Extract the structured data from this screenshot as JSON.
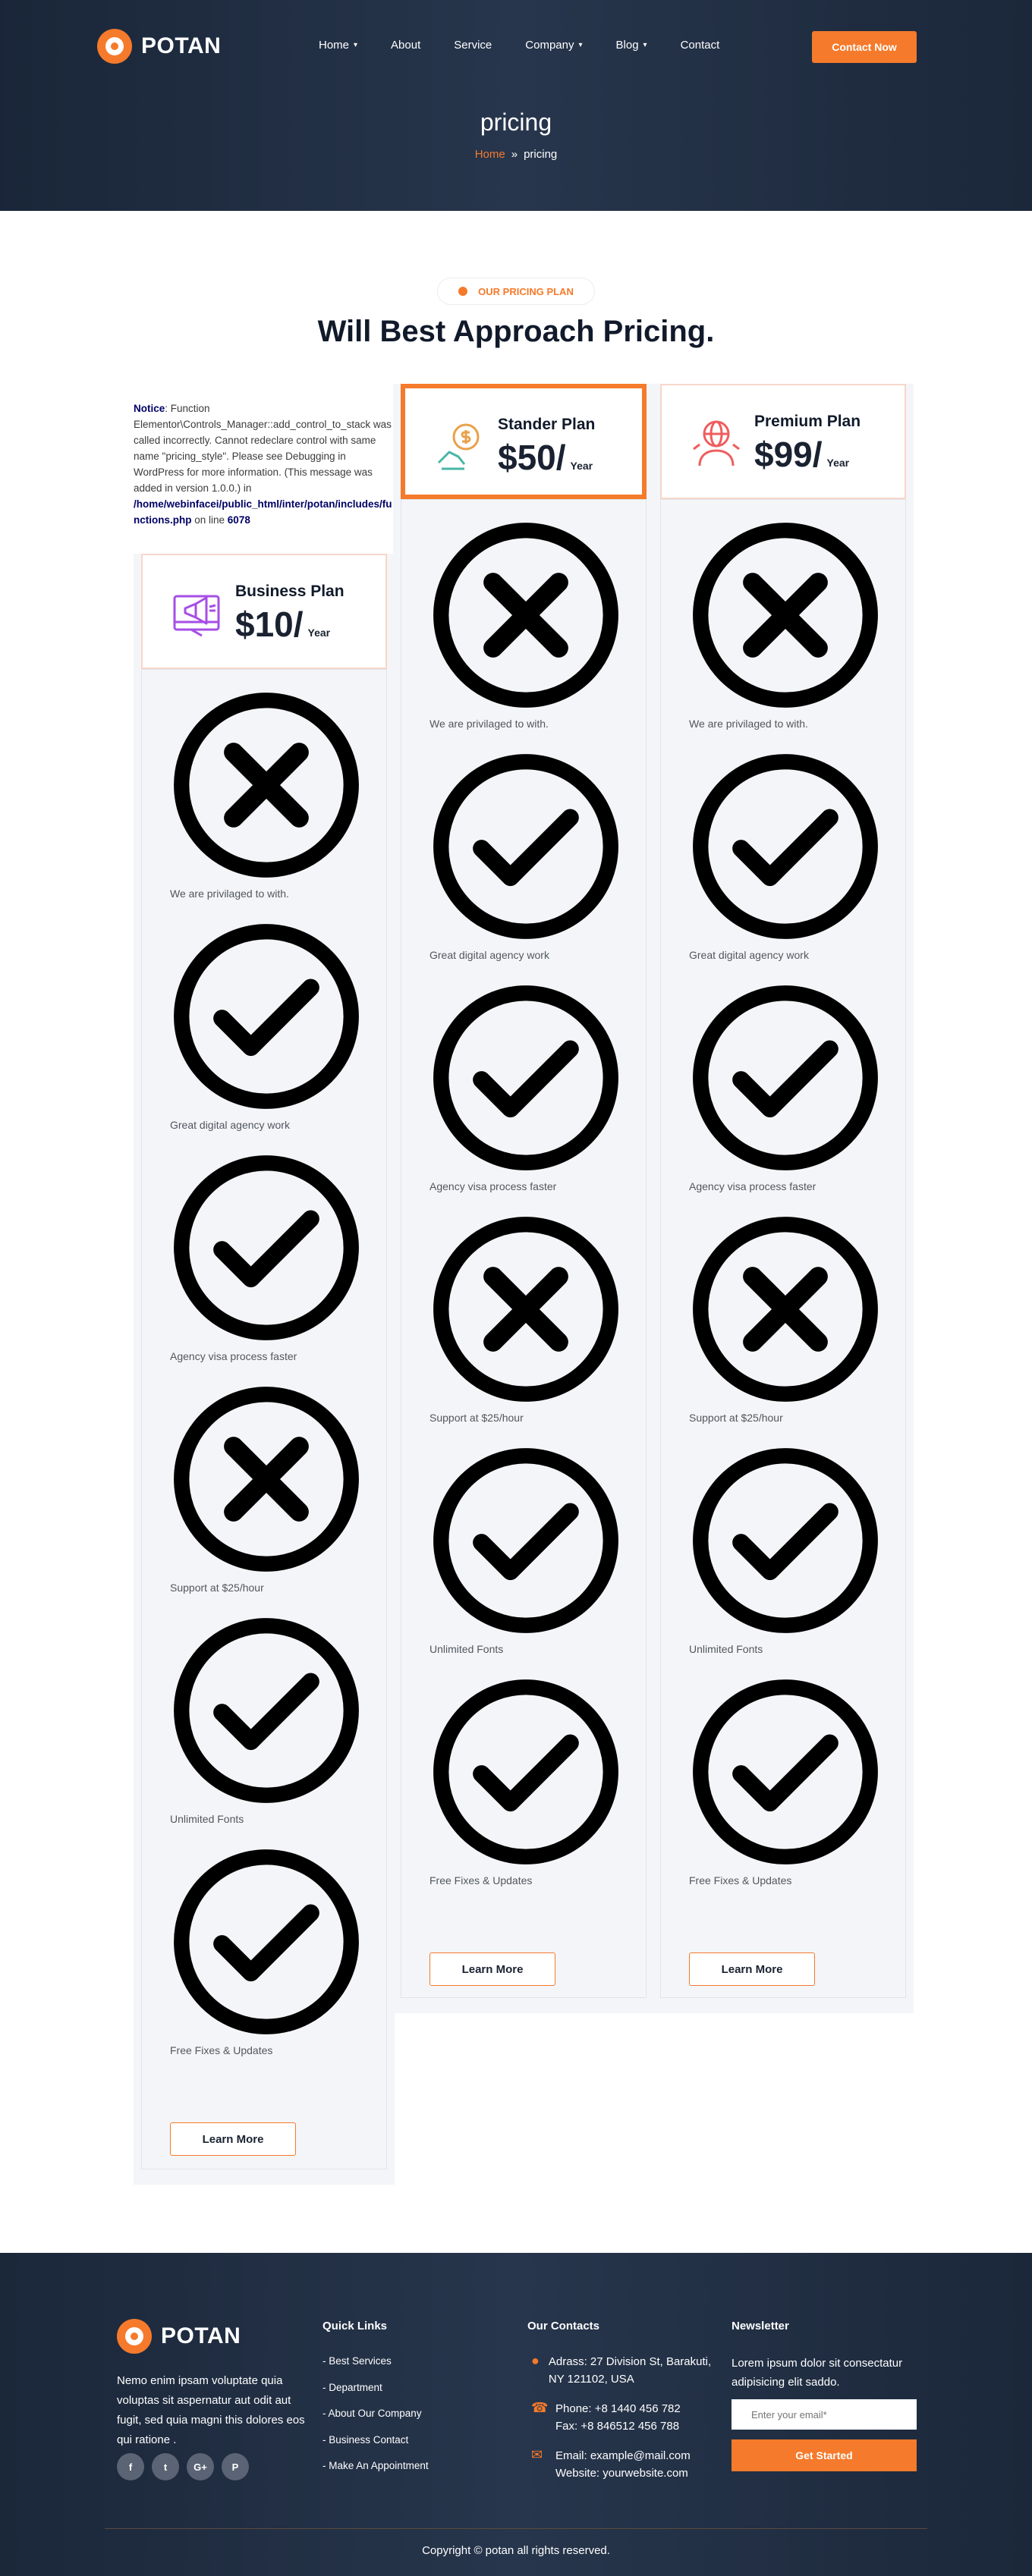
{
  "brand": {
    "name": "POTAN",
    "accent": "#f57a2b",
    "dark": "#27354b"
  },
  "nav": {
    "items": [
      {
        "label": "Home",
        "dropdown": true
      },
      {
        "label": "About",
        "dropdown": false
      },
      {
        "label": "Service",
        "dropdown": false
      },
      {
        "label": "Company",
        "dropdown": true
      },
      {
        "label": "Blog",
        "dropdown": true
      },
      {
        "label": "Contact",
        "dropdown": false
      }
    ],
    "cta": "Contact Now"
  },
  "hero": {
    "title": "pricing",
    "breadcrumb": {
      "home": "Home",
      "separator": "»",
      "current": "pricing"
    }
  },
  "section": {
    "tag": "OUR PRICING PLAN",
    "title": "Will Best Approach Pricing."
  },
  "notice": {
    "label": "Notice",
    "text": ": Function Elementor\\Controls_Manager::add_control_to_stack was called incorrectly. Cannot redeclare control with same name \"pricing_style\". Please see Debugging in WordPress for more information. (This message was added in version 1.0.0.) in ",
    "path": "/home/webinfacei/public_html/inter/potan/includes/functions.php",
    "line_prefix": " on line ",
    "line": "6078"
  },
  "plans": [
    {
      "name": "Business Plan",
      "price": "$10/",
      "period": "Year",
      "icon": "megaphone-icon",
      "features": [
        {
          "label": "We are privilaged to with.",
          "included": false
        },
        {
          "label": "Great digital agency work",
          "included": true
        },
        {
          "label": "Agency visa process faster",
          "included": true
        },
        {
          "label": "Support at $25/hour",
          "included": false
        },
        {
          "label": "Unlimited Fonts",
          "included": true
        },
        {
          "label": "Free Fixes & Updates",
          "included": true
        }
      ],
      "button": "Learn More"
    },
    {
      "name": "Stander Plan",
      "price": "$50/",
      "period": "Year",
      "icon": "money-idea-icon",
      "features": [
        {
          "label": "We are privilaged to with.",
          "included": false
        },
        {
          "label": "Great digital agency work",
          "included": true
        },
        {
          "label": "Agency visa process faster",
          "included": true
        },
        {
          "label": "Support at $25/hour",
          "included": false
        },
        {
          "label": "Unlimited Fonts",
          "included": true
        },
        {
          "label": "Free Fixes & Updates",
          "included": true
        }
      ],
      "button": "Learn More"
    },
    {
      "name": "Premium Plan",
      "price": "$99/",
      "period": "Year",
      "icon": "global-user-icon",
      "features": [
        {
          "label": "We are privilaged to with.",
          "included": false
        },
        {
          "label": "Great digital agency work",
          "included": true
        },
        {
          "label": "Agency visa process faster",
          "included": true
        },
        {
          "label": "Support at $25/hour",
          "included": false
        },
        {
          "label": "Unlimited Fonts",
          "included": true
        },
        {
          "label": "Free Fixes & Updates",
          "included": true
        }
      ],
      "button": "Learn More"
    }
  ],
  "footer": {
    "about": "Nemo enim ipsam voluptate quia voluptas sit aspernatur aut odit aut fugit, sed quia magni this dolores eos qui ratione .",
    "socials": [
      "f",
      "t",
      "G+",
      "P"
    ],
    "quick_links_title": "Quick Links",
    "quick_links": [
      "- Best Services",
      "- Department",
      "- About Our Company",
      "- Business Contact",
      "- Make An Appointment"
    ],
    "contacts_title": "Our Contacts",
    "address": "Adrass: 27 Division St, Barakuti, NY 121102, USA",
    "phone": "Phone: +8 1440 456 782",
    "fax": "Fax: +8 846512 456 788",
    "email": "Email: example@mail.com",
    "website": "Website: yourwebsite.com",
    "newsletter_title": "Newsletter",
    "newsletter_text": "Lorem ipsum dolor sit consectatur adipisicing elit saddo.",
    "email_placeholder": "Enter your email*",
    "newsletter_button": "Get Started",
    "copyright": "Copyright © potan all rights reserved."
  }
}
